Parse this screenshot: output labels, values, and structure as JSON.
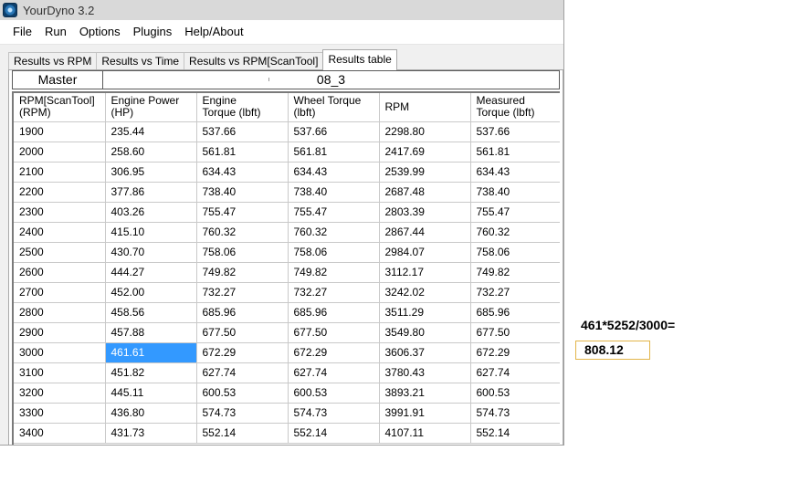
{
  "window": {
    "title": "YourDyno 3.2"
  },
  "menu": [
    "File",
    "Run",
    "Options",
    "Plugins",
    "Help/About"
  ],
  "tabs": [
    {
      "label": "Results vs RPM",
      "active": false
    },
    {
      "label": "Results vs Time",
      "active": false
    },
    {
      "label": "Results vs RPM[ScanTool]",
      "active": false
    },
    {
      "label": "Results table",
      "active": true
    }
  ],
  "table": {
    "master_label": "Master",
    "run_name": "08_3",
    "columns": [
      [
        "RPM[ScanTool]",
        "(RPM)"
      ],
      [
        "Engine Power",
        "(HP)"
      ],
      [
        "Engine",
        "Torque (lbft)"
      ],
      [
        "Wheel Torque",
        "(lbft)"
      ],
      [
        "RPM",
        ""
      ],
      [
        "Measured",
        "Torque (lbft)"
      ]
    ],
    "rows": [
      [
        "1900",
        "235.44",
        "537.66",
        "537.66",
        "2298.80",
        "537.66"
      ],
      [
        "2000",
        "258.60",
        "561.81",
        "561.81",
        "2417.69",
        "561.81"
      ],
      [
        "2100",
        "306.95",
        "634.43",
        "634.43",
        "2539.99",
        "634.43"
      ],
      [
        "2200",
        "377.86",
        "738.40",
        "738.40",
        "2687.48",
        "738.40"
      ],
      [
        "2300",
        "403.26",
        "755.47",
        "755.47",
        "2803.39",
        "755.47"
      ],
      [
        "2400",
        "415.10",
        "760.32",
        "760.32",
        "2867.44",
        "760.32"
      ],
      [
        "2500",
        "430.70",
        "758.06",
        "758.06",
        "2984.07",
        "758.06"
      ],
      [
        "2600",
        "444.27",
        "749.82",
        "749.82",
        "3112.17",
        "749.82"
      ],
      [
        "2700",
        "452.00",
        "732.27",
        "732.27",
        "3242.02",
        "732.27"
      ],
      [
        "2800",
        "458.56",
        "685.96",
        "685.96",
        "3511.29",
        "685.96"
      ],
      [
        "2900",
        "457.88",
        "677.50",
        "677.50",
        "3549.80",
        "677.50"
      ],
      [
        "3000",
        "461.61",
        "672.29",
        "672.29",
        "3606.37",
        "672.29"
      ],
      [
        "3100",
        "451.82",
        "627.74",
        "627.74",
        "3780.43",
        "627.74"
      ],
      [
        "3200",
        "445.11",
        "600.53",
        "600.53",
        "3893.21",
        "600.53"
      ],
      [
        "3300",
        "436.80",
        "574.73",
        "574.73",
        "3991.91",
        "574.73"
      ],
      [
        "3400",
        "431.73",
        "552.14",
        "552.14",
        "4107.11",
        "552.14"
      ]
    ],
    "selected_cell": {
      "row": 11,
      "col": 1
    }
  },
  "annotation": {
    "formula": "461*5252/3000=",
    "result": "808.12"
  },
  "colors": {
    "selection": "#3399ff",
    "result_border": "#e2b54a"
  }
}
